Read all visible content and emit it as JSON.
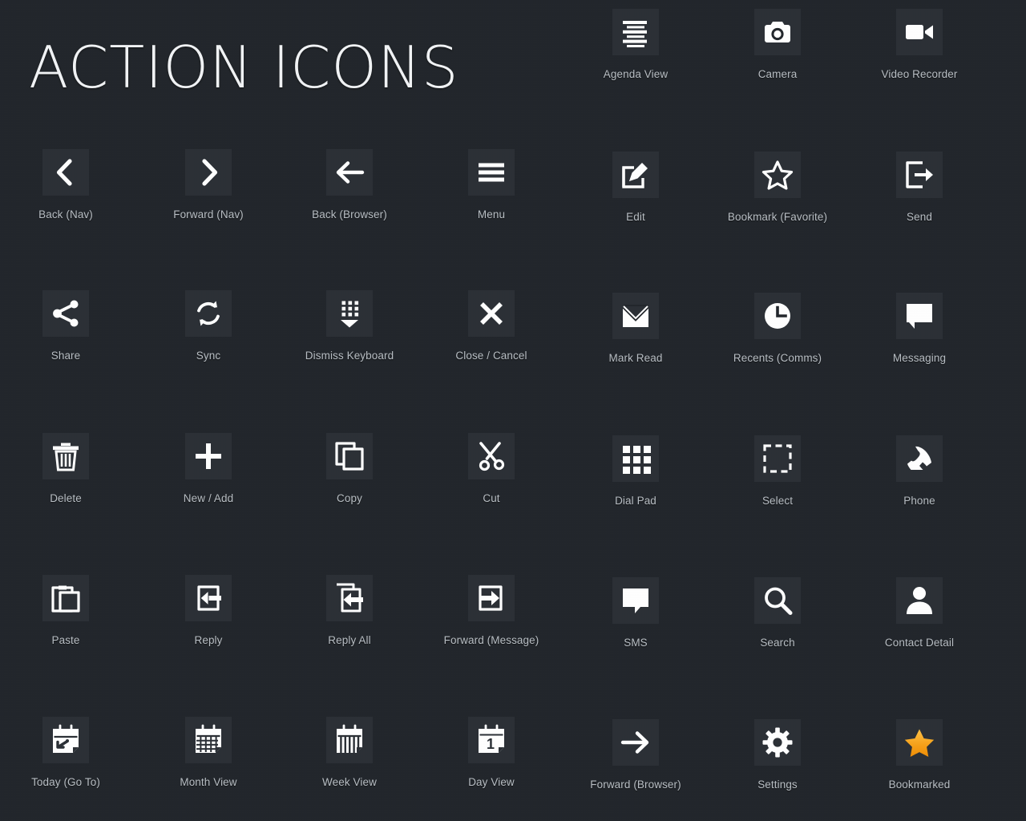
{
  "page": {
    "title": "ACTION ICONS",
    "background_color": "#22262b",
    "tile_color": "#2b3036",
    "icon_color": "#ffffff",
    "label_color": "#b9bfc5",
    "accent_color": "#f5a11e"
  },
  "icons": [
    {
      "id": "agenda-view",
      "label": "Agenda View",
      "glyph": "agenda",
      "col": 5,
      "row": 1
    },
    {
      "id": "camera",
      "label": "Camera",
      "glyph": "camera",
      "col": 6,
      "row": 1
    },
    {
      "id": "video-recorder",
      "label": "Video Recorder",
      "glyph": "video",
      "col": 7,
      "row": 1
    },
    {
      "id": "back-nav",
      "label": "Back (Nav)",
      "glyph": "chevron-left",
      "col": 1,
      "row": 2
    },
    {
      "id": "forward-nav",
      "label": "Forward (Nav)",
      "glyph": "chevron-right",
      "col": 2,
      "row": 2
    },
    {
      "id": "back-browser",
      "label": "Back (Browser)",
      "glyph": "arrow-left",
      "col": 3,
      "row": 2
    },
    {
      "id": "menu",
      "label": "Menu",
      "glyph": "menu",
      "col": 4,
      "row": 2
    },
    {
      "id": "edit",
      "label": "Edit",
      "glyph": "edit",
      "col": 5,
      "row": 2
    },
    {
      "id": "bookmark-favorite",
      "label": "Bookmark (Favorite)",
      "glyph": "star-outline",
      "col": 6,
      "row": 2
    },
    {
      "id": "send",
      "label": "Send",
      "glyph": "send",
      "col": 7,
      "row": 2
    },
    {
      "id": "share",
      "label": "Share",
      "glyph": "share",
      "col": 1,
      "row": 3
    },
    {
      "id": "sync",
      "label": "Sync",
      "glyph": "sync",
      "col": 2,
      "row": 3
    },
    {
      "id": "dismiss-keyboard",
      "label": "Dismiss Keyboard",
      "glyph": "dismiss-kbd",
      "col": 3,
      "row": 3
    },
    {
      "id": "close-cancel",
      "label": "Close / Cancel",
      "glyph": "close",
      "col": 4,
      "row": 3
    },
    {
      "id": "mark-read",
      "label": "Mark Read",
      "glyph": "envelope-open",
      "col": 5,
      "row": 3
    },
    {
      "id": "recents-comms",
      "label": "Recents (Comms)",
      "glyph": "clock",
      "col": 6,
      "row": 3
    },
    {
      "id": "messaging",
      "label": "Messaging",
      "glyph": "chat-right",
      "col": 7,
      "row": 3
    },
    {
      "id": "delete",
      "label": "Delete",
      "glyph": "trash",
      "col": 1,
      "row": 4
    },
    {
      "id": "new-add",
      "label": "New / Add",
      "glyph": "plus",
      "col": 2,
      "row": 4
    },
    {
      "id": "copy",
      "label": "Copy",
      "glyph": "copy",
      "col": 3,
      "row": 4
    },
    {
      "id": "cut",
      "label": "Cut",
      "glyph": "scissors",
      "col": 4,
      "row": 4
    },
    {
      "id": "dial-pad",
      "label": "Dial Pad",
      "glyph": "dialpad",
      "col": 5,
      "row": 4
    },
    {
      "id": "select",
      "label": "Select",
      "glyph": "select",
      "col": 6,
      "row": 4
    },
    {
      "id": "phone",
      "label": "Phone",
      "glyph": "phone",
      "col": 7,
      "row": 4
    },
    {
      "id": "paste",
      "label": "Paste",
      "glyph": "paste",
      "col": 1,
      "row": 5
    },
    {
      "id": "reply",
      "label": "Reply",
      "glyph": "reply",
      "col": 2,
      "row": 5
    },
    {
      "id": "reply-all",
      "label": "Reply All",
      "glyph": "reply-all",
      "col": 3,
      "row": 5
    },
    {
      "id": "forward-message",
      "label": "Forward (Message)",
      "glyph": "forward-msg",
      "col": 4,
      "row": 5
    },
    {
      "id": "sms",
      "label": "SMS",
      "glyph": "chat-left",
      "col": 5,
      "row": 5
    },
    {
      "id": "search",
      "label": "Search",
      "glyph": "search",
      "col": 6,
      "row": 5
    },
    {
      "id": "contact-detail",
      "label": "Contact Detail",
      "glyph": "person",
      "col": 7,
      "row": 5
    },
    {
      "id": "today-go-to",
      "label": "Today (Go To)",
      "glyph": "cal-today",
      "col": 1,
      "row": 6
    },
    {
      "id": "month-view",
      "label": "Month View",
      "glyph": "cal-month",
      "col": 2,
      "row": 6
    },
    {
      "id": "week-view",
      "label": "Week View",
      "glyph": "cal-week",
      "col": 3,
      "row": 6
    },
    {
      "id": "day-view",
      "label": "Day View",
      "glyph": "cal-day",
      "col": 4,
      "row": 6,
      "day_number": "1"
    },
    {
      "id": "forward-browser",
      "label": "Forward (Browser)",
      "glyph": "arrow-right",
      "col": 5,
      "row": 6
    },
    {
      "id": "settings",
      "label": "Settings",
      "glyph": "gear",
      "col": 6,
      "row": 6
    },
    {
      "id": "bookmarked",
      "label": "Bookmarked",
      "glyph": "star-filled",
      "col": 7,
      "row": 6
    }
  ]
}
